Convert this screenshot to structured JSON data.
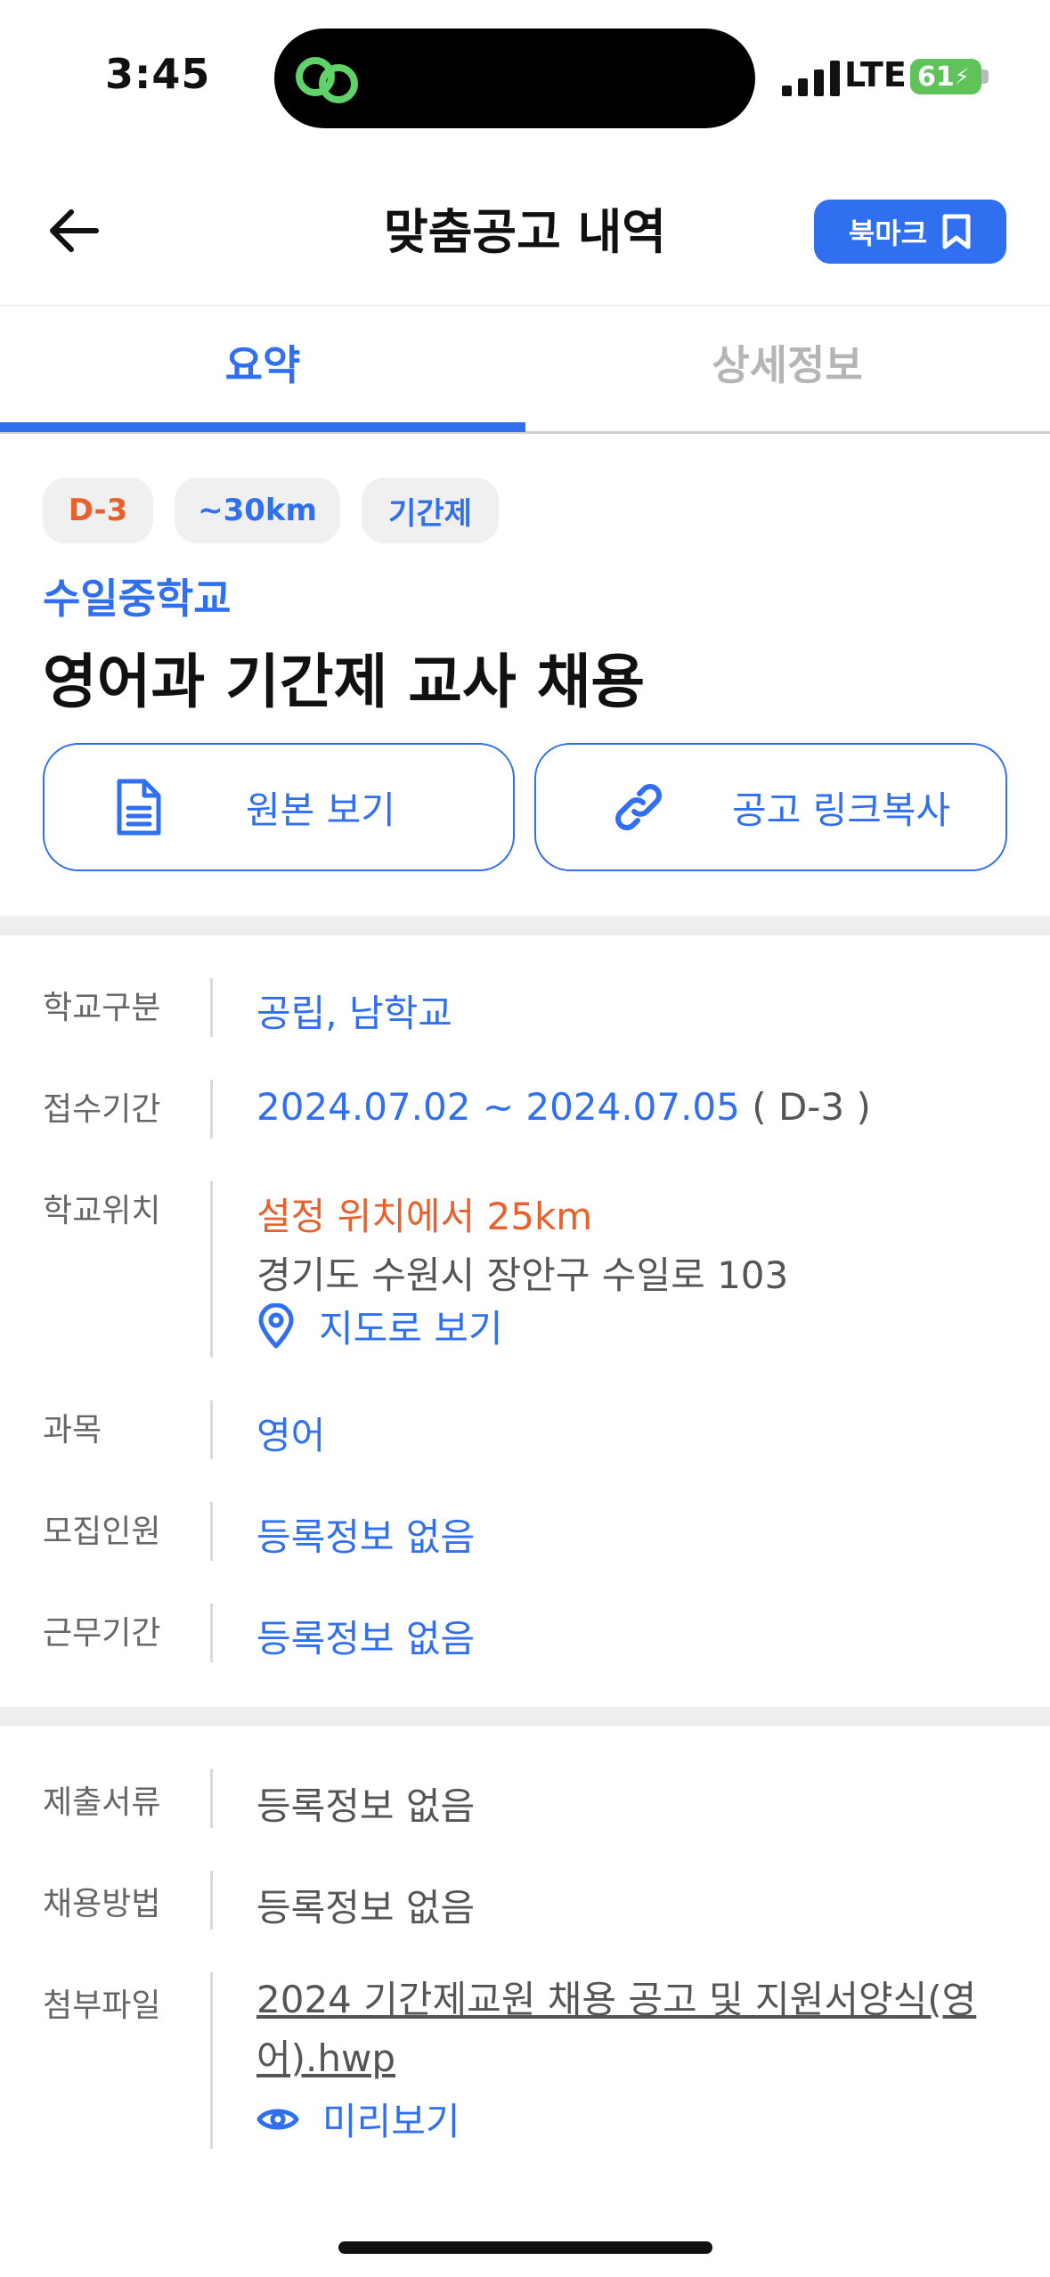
{
  "status_bar": {
    "time": "3:45",
    "network": "LTE",
    "battery": "61"
  },
  "header": {
    "title": "맞춤공고 내역",
    "bookmark_label": "북마크"
  },
  "tabs": [
    {
      "label": "요약",
      "active": true
    },
    {
      "label": "상세정보",
      "active": false
    }
  ],
  "chips": {
    "deadline": "D-3",
    "distance": "~30km",
    "type": "기간제"
  },
  "school_name": "수일중학교",
  "job_title": "영어과 기간제 교사 채용",
  "actions": {
    "view_original": "원본 보기",
    "copy_link": "공고 링크복사"
  },
  "info": {
    "school_type": {
      "label": "학교구분",
      "value": "공립, 남학교"
    },
    "period": {
      "label": "접수기간",
      "value": "2024.07.02 ~ 2024.07.05",
      "dday": "( D-3 )"
    },
    "location": {
      "label": "학교위치",
      "distance": "설정 위치에서 25km",
      "address": "경기도 수원시 장안구 수일로 103",
      "map_link": "지도로 보기"
    },
    "subject": {
      "label": "과목",
      "value": "영어"
    },
    "headcount": {
      "label": "모집인원",
      "value": "등록정보 없음"
    },
    "work_period": {
      "label": "근무기간",
      "value": "등록정보 없음"
    }
  },
  "extra": {
    "documents": {
      "label": "제출서류",
      "value": "등록정보 없음"
    },
    "method": {
      "label": "채용방법",
      "value": "등록정보 없음"
    },
    "attachment": {
      "label": "첨부파일",
      "file_name": "2024 기간제교원 채용 공고 및 지원서양식(영어).hwp",
      "preview": "미리보기"
    }
  },
  "colors": {
    "accent": "#2f6ff0",
    "warning": "#e8602c",
    "battery": "#5fc35a"
  }
}
